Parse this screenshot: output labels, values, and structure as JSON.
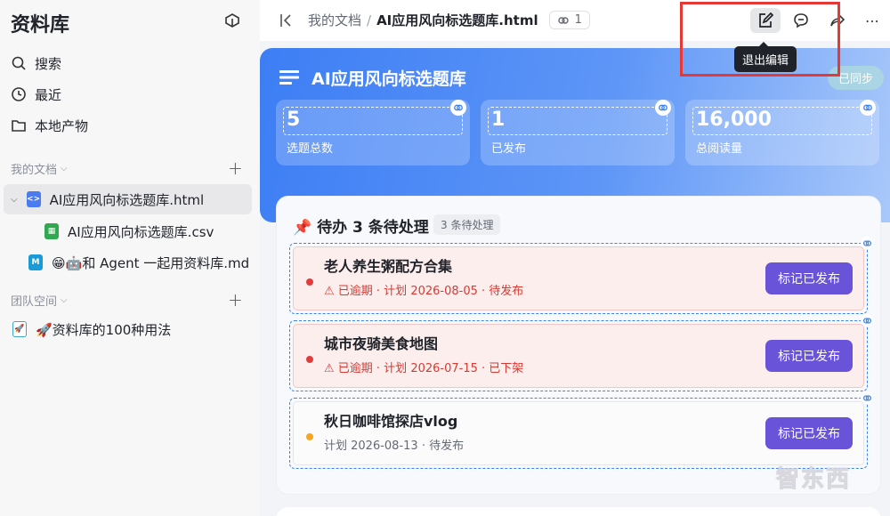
{
  "sidebar": {
    "title": "资料库",
    "nav": [
      {
        "label": "搜索",
        "icon": "search-icon"
      },
      {
        "label": "最近",
        "icon": "clock-icon"
      },
      {
        "label": "本地产物",
        "icon": "folder-icon"
      }
    ],
    "my_docs": {
      "label": "我的文档",
      "items": [
        {
          "label": "AI应用风向标选题库.html",
          "icon": "html-file-icon"
        },
        {
          "label": "AI应用风向标选题库.csv",
          "icon": "csv-file-icon"
        },
        {
          "label": "😁🤖和 Agent 一起用资料库.md",
          "icon": "markdown-file-icon"
        }
      ]
    },
    "team": {
      "label": "团队空间",
      "items": [
        {
          "label": "🚀资料库的100种用法",
          "icon": "rocket-icon"
        }
      ]
    }
  },
  "topbar": {
    "crumb_parent": "我的文档",
    "crumb_sep": "/",
    "crumb_current": "AI应用风向标选题库.html",
    "link_count": "1",
    "tooltip": "退出编辑"
  },
  "hero": {
    "title": "AI应用风向标选题库",
    "sync": "已同步",
    "stats": [
      {
        "value": "5",
        "label": "选题总数"
      },
      {
        "value": "1",
        "label": "已发布"
      },
      {
        "value": "16,000",
        "label": "总阅读量"
      }
    ]
  },
  "todo": {
    "title": "📌 待办 3 条待处理",
    "badge": "3 条待处理",
    "items": [
      {
        "title": "老人养生粥配方合集",
        "meta": "⚠ 已逾期 · 计划 2026-08-05 · 待发布",
        "button": "标记已发布",
        "status": "overdue"
      },
      {
        "title": "城市夜骑美食地图",
        "meta": "⚠ 已逾期 · 计划 2026-07-15 · 已下架",
        "button": "标记已发布",
        "status": "overdue"
      },
      {
        "title": "秋日咖啡馆探店vlog",
        "meta": "计划 2026-08-13 · 待发布",
        "button": "标记已发布",
        "status": "normal"
      }
    ]
  },
  "colors": {
    "accent": "#6953d8",
    "overdue_dot": "#e23b3b",
    "pending_dot": "#f5a623",
    "hero_blue": "#3d7ef5",
    "highlight_red": "#e53935"
  },
  "watermark": "智东西"
}
